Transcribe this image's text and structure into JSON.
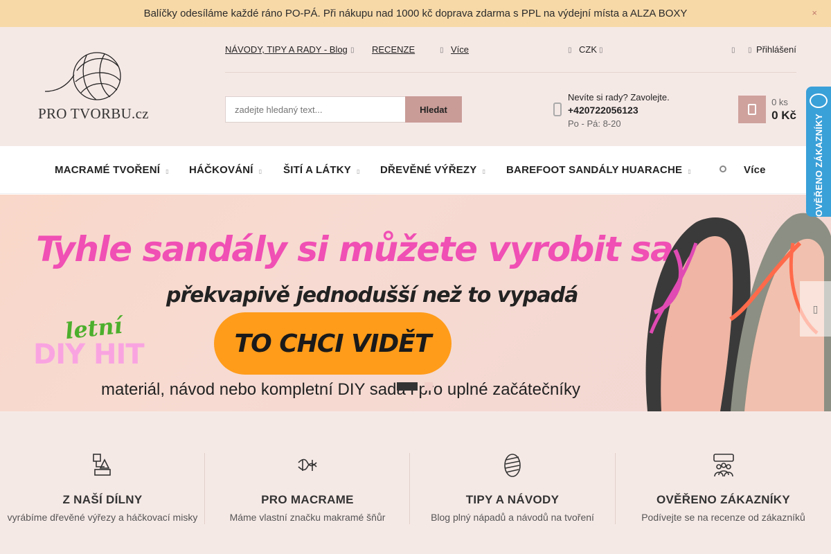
{
  "announcement": {
    "text": "Balíčky odesíláme každé ráno PO-PÁ. Při nákupu nad 1000 kč doprava zdarma s PPL na výdejní místa a ALZA BOXY",
    "close_icon": "×"
  },
  "logo": {
    "text": "PRO TVORBU.cz"
  },
  "toplinks": {
    "blog": "NÁVODY, TIPY A RADY - Blog",
    "reviews": "RECENZE",
    "more": "Více",
    "currency": "CZK",
    "login": "Přihlášení"
  },
  "search": {
    "placeholder": "zadejte hledaný text...",
    "button": "Hledat"
  },
  "help": {
    "prompt": "Nevíte si rady? Zavolejte.",
    "phone": "+420722056123",
    "hours": "Po - Pá: 8-20"
  },
  "cart": {
    "qty": "0 ks",
    "price": "0 Kč"
  },
  "nav": {
    "items": [
      "MACRAMÉ TVOŘENÍ",
      "HÁČKOVÁNÍ",
      "ŠITÍ A LÁTKY",
      "DŘEVĚNÉ VÝŘEZY",
      "BAREFOOT SANDÁLY HUARACHE"
    ],
    "more": "Více"
  },
  "banner": {
    "title": "Tyhle sandály si můžete vyrobit sami",
    "subtitle": "překvapivě jednodušší než to vypadá",
    "letni": "letní",
    "diyhit": "DIY HIT",
    "cta": "TO CHCI VIDĚT",
    "bottom": "materiál, návod nebo kompletní DIY sada i pro uplné začátečníky"
  },
  "verified_badge": {
    "text": "OVĚŘENO ZÁKAZNÍKY"
  },
  "features": [
    {
      "icon": "workshop-icon",
      "title": "Z NAŠÍ DÍLNY",
      "desc": "vyrábíme dřevěné výřezy a háčkovací misky"
    },
    {
      "icon": "macrame-icon",
      "title": "PRO MACRAME",
      "desc": "Máme vlastní značku makramé šňůr"
    },
    {
      "icon": "yarn-icon",
      "title": "TIPY A NÁVODY",
      "desc": "Blog plný nápadů a návodů na tvoření"
    },
    {
      "icon": "customers-icon",
      "title": "OVĚŘENO ZÁKAZNÍKY",
      "desc": "Podívejte se na recenze od zákazníků"
    }
  ],
  "colors": {
    "announcement_bg": "#f7d9a8",
    "header_bg": "#f5e9e6",
    "accent": "#c99c97",
    "cta": "#ff9c1a",
    "banner_title": "#f04fb4",
    "verified_badge": "#3aa0d8"
  }
}
